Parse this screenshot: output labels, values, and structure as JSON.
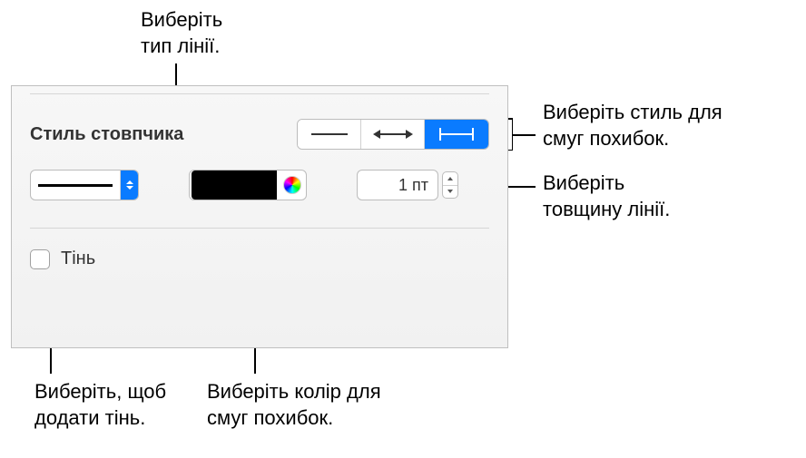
{
  "panel": {
    "title": "Стиль стовпчика",
    "thickness_value": "1 пт",
    "shadow_label": "Тінь"
  },
  "callouts": {
    "line_type": "Виберіть\nтип лінії.",
    "bar_style": "Виберіть стиль для\nсмуг похибок.",
    "thickness": "Виберіть\nтовщину лінії.",
    "shadow": "Виберіть, щоб\nдодати тінь.",
    "color": "Виберіть колір для\nсмуг похибок."
  }
}
